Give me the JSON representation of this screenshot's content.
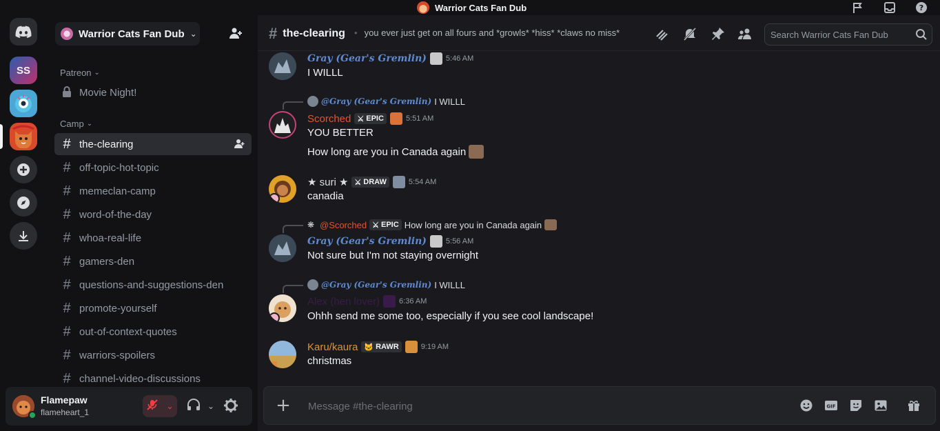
{
  "window": {
    "title": "Warrior Cats Fan Dub"
  },
  "guilds": [
    {
      "name": "SS",
      "color": "#7b2c8f"
    }
  ],
  "server": {
    "name": "Warrior Cats Fan Dub"
  },
  "categories": {
    "patreon": "Patreon",
    "camp": "Camp"
  },
  "patreon_channel": "Movie Night!",
  "channels": [
    "the-clearing",
    "off-topic-hot-topic",
    "memeclan-camp",
    "word-of-the-day",
    "whoa-real-life",
    "gamers-den",
    "questions-and-suggestions-den",
    "promote-yourself",
    "out-of-context-quotes",
    "warriors-spoilers",
    "channel-video-discussions"
  ],
  "user": {
    "display_name": "Flamepaw",
    "username": "flameheart_1"
  },
  "header": {
    "channel": "the-clearing",
    "topic": "you ever just get on all fours and *growls* *hiss* *claws no miss*",
    "search_placeholder": "Search Warrior Cats Fan Dub"
  },
  "messages": [
    {
      "author": "Gray (Gear's Gremlin)",
      "time": "5:46 AM",
      "lines": [
        "I WILLL"
      ]
    },
    {
      "reply_to": "@Gray (Gear's Gremlin)",
      "reply_text": "I WILLL",
      "author": "Scorched",
      "tag": "EPIC",
      "time": "5:51 AM",
      "lines": [
        "YOU BETTER",
        "How long are you in Canada again"
      ]
    },
    {
      "author": "★ suri ★",
      "tag": "DRAW",
      "time": "5:54 AM",
      "lines": [
        "canadia"
      ]
    },
    {
      "reply_to": "@Scorched",
      "reply_tag": "EPIC",
      "reply_text": "How long are you in Canada again",
      "author": "Gray (Gear's Gremlin)",
      "time": "5:56 AM",
      "lines": [
        "Not sure but I'm not staying overnight"
      ]
    },
    {
      "reply_to": "@Gray (Gear's Gremlin)",
      "reply_text": "I WILLL",
      "author": "Alex (hen lover)",
      "time": "6:36 AM",
      "lines": [
        "Ohhh send me some too, especially if you see cool landscape!"
      ]
    },
    {
      "author": "Karu/kaura",
      "tag": "RAWR",
      "time": "9:19 AM",
      "lines": [
        "christmas"
      ]
    }
  ],
  "composer": {
    "placeholder": "Message #the-clearing"
  },
  "colors": {
    "accent": "#5865f2",
    "online": "#23a55a",
    "danger": "#f23f43"
  }
}
